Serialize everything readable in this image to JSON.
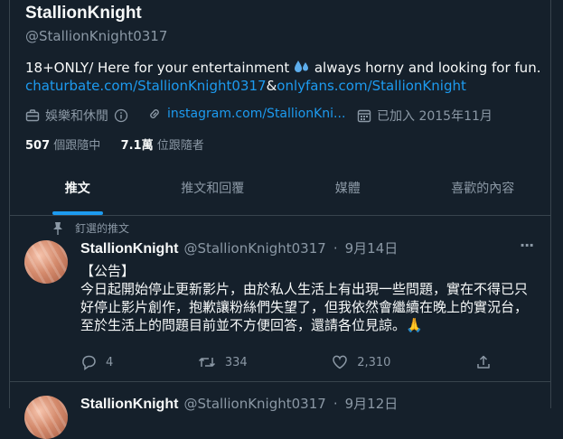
{
  "profile": {
    "display_name": "StallionKnight",
    "at_symbol": "@",
    "handle": "StallionKnight0317",
    "bio_line1_a": "18+ONLY/ Here for your entertainment",
    "bio_line1_b": "always horny and looking for fun.",
    "link1": "chaturbate.com/StallionKnight0317",
    "ampersand": "&",
    "link2": "onlyfans.com/StallionKnight",
    "category": "娛樂和休閒",
    "website": "instagram.com/StallionKni...",
    "joined": "已加入 2015年11月",
    "following_count": "507",
    "following_label": "個跟隨中",
    "followers_count": "7.1萬",
    "followers_label": "位跟隨者"
  },
  "tabs": [
    {
      "label": "推文"
    },
    {
      "label": "推文和回覆"
    },
    {
      "label": "媒體"
    },
    {
      "label": "喜歡的內容"
    }
  ],
  "pinned_tweet": {
    "pinned_label": "釘選的推文",
    "name": "StallionKnight",
    "handle": "@StallionKnight0317",
    "separator": "·",
    "date": "9月14日",
    "more": "···",
    "text_line0": "【公告】",
    "text_body": "今日起開始停止更新影片，由於私人生活上有出現一些問題，實在不得已只好停止影片創作，抱歉讓粉絲們失望了，但我依然會繼續在晚上的實況台，至於生活上的問題目前並不方便回答，還請各位見諒。",
    "emoji": "🙏",
    "replies": "4",
    "retweets": "334",
    "likes": "2,310"
  },
  "next_tweet": {
    "name": "StallionKnight",
    "handle": "@StallionKnight0317",
    "separator": "·",
    "date": "9月12日"
  },
  "colors": {
    "background": "#15202b",
    "accent": "#1d9bf0",
    "muted": "#8b98a5",
    "border": "#38444d"
  }
}
